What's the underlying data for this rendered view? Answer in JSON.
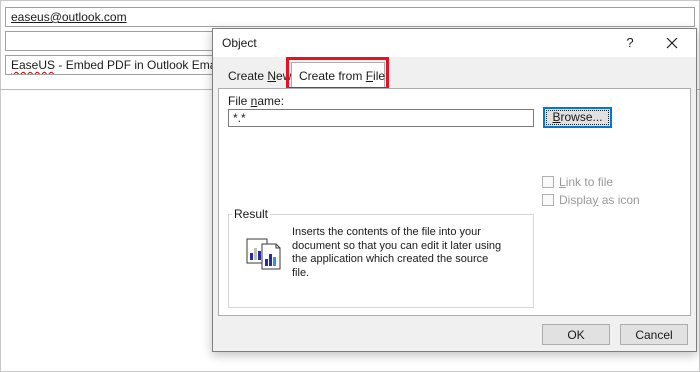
{
  "email": {
    "to": "easeus@outlook.com",
    "cc": "",
    "subject_prefix": "EaseUS",
    "subject_rest": " - Embed PDF in Outlook Email"
  },
  "dialog": {
    "title": "Object",
    "help": "?",
    "tabs": [
      {
        "pre": "Create ",
        "ul": "N",
        "post": "ew",
        "active": false
      },
      {
        "pre": "Create from ",
        "ul": "F",
        "post": "ile",
        "active": true
      }
    ],
    "file_name_label": {
      "pre": "File ",
      "ul": "n",
      "post": "ame:"
    },
    "file_name_value": "*.*",
    "browse_label": {
      "ul": "B",
      "post": "rowse..."
    },
    "link_to_file": {
      "pre": "",
      "ul": "L",
      "post": "ink to file",
      "checked": false,
      "enabled": false
    },
    "display_as_icon": {
      "pre": "Displa",
      "ul": "y",
      "post": " as icon",
      "checked": false,
      "enabled": false
    },
    "result_legend": "Result",
    "result_lines": [
      "Inserts the contents of the file into your",
      "document so that you can edit it later using",
      "the application which created the source",
      "file."
    ],
    "ok_label": "OK",
    "cancel_label": "Cancel",
    "highlight_color": "#e81123",
    "focus_color": "#0078d7"
  }
}
